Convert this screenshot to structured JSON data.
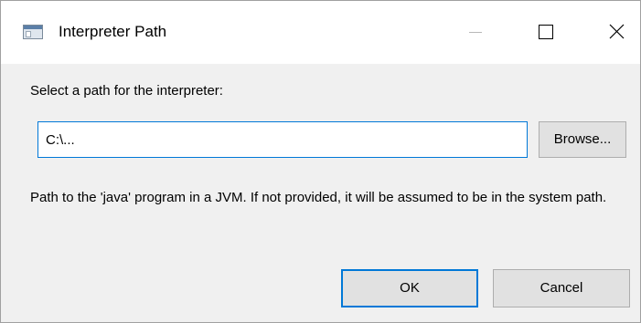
{
  "window": {
    "title": "Interpreter Path",
    "icon": "app-window-icon",
    "controls": {
      "minimize_icon": "minimize-icon",
      "maximize_icon": "maximize-icon",
      "close_icon": "close-icon"
    }
  },
  "form": {
    "prompt": "Select a path for the interpreter:",
    "path_value": "C:\\...",
    "browse_label": "Browse...",
    "help_text": "Path to the 'java' program in a JVM. If not provided, it will be assumed to be in the system path."
  },
  "buttons": {
    "ok_label": "OK",
    "cancel_label": "Cancel"
  },
  "colors": {
    "accent": "#0078d7",
    "dialog_background": "#f0f0f0",
    "button_face": "#e1e1e1"
  }
}
